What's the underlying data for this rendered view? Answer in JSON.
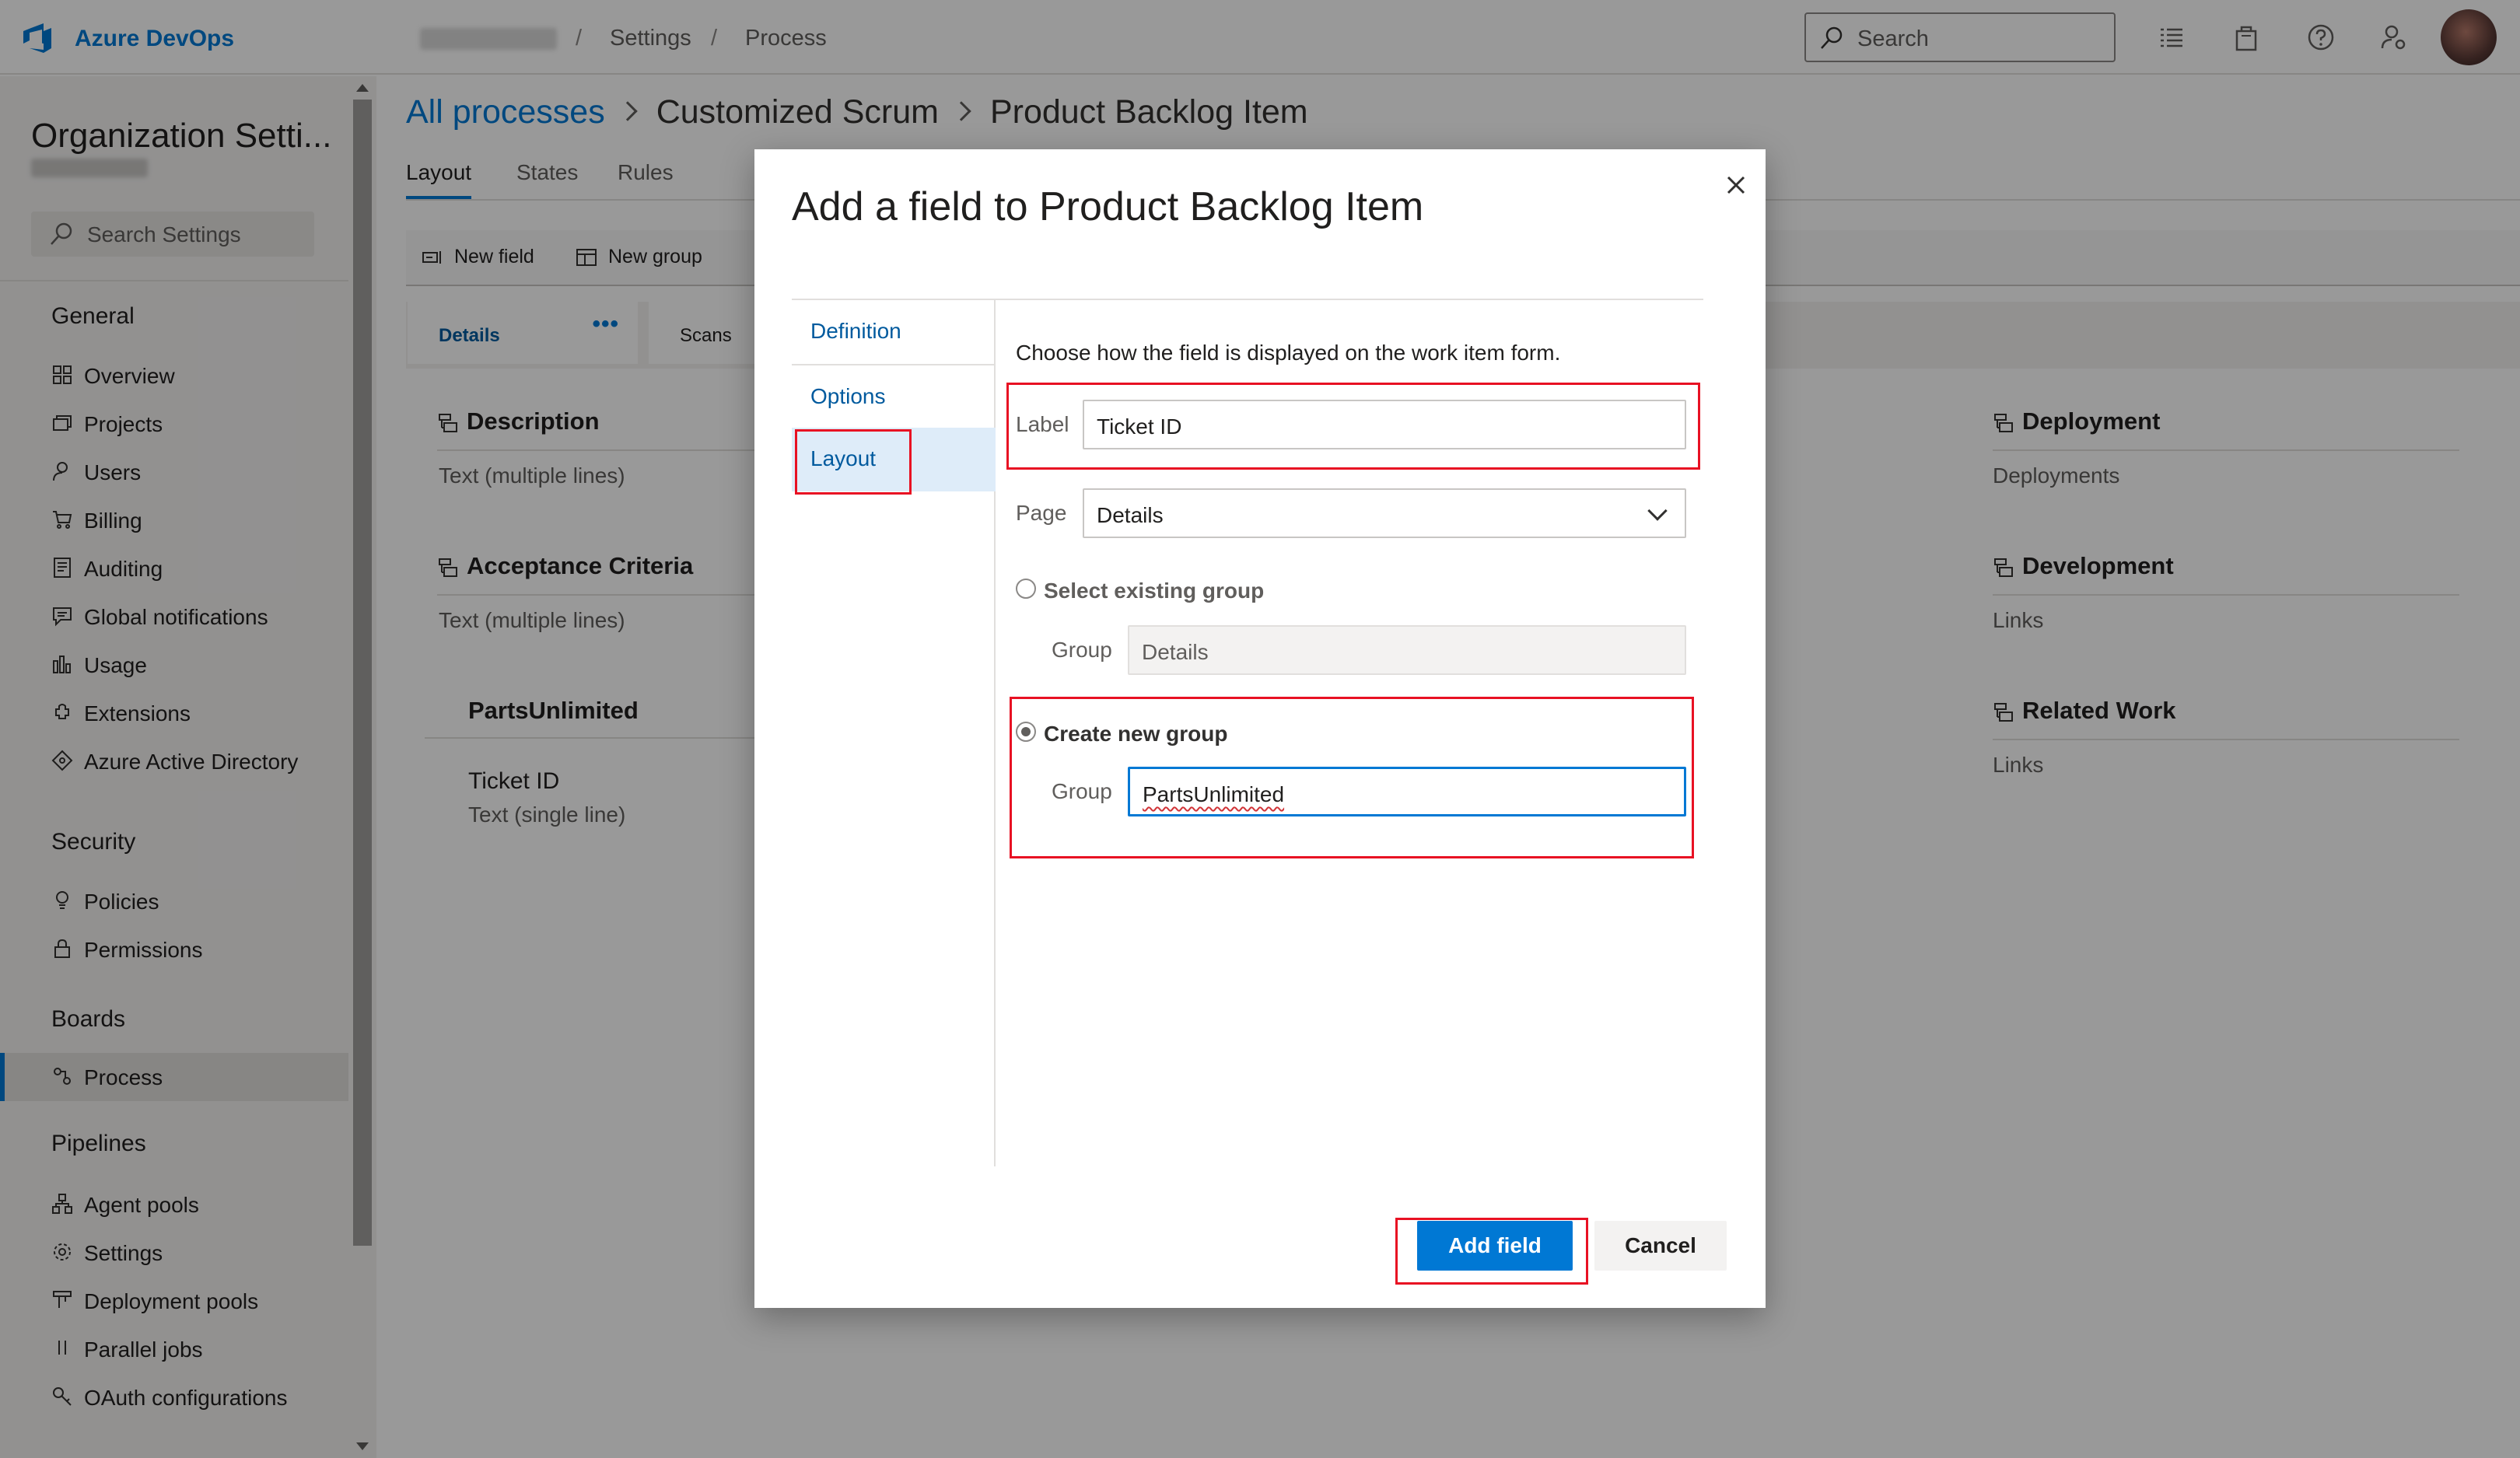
{
  "topbar": {
    "brand": "Azure DevOps",
    "breadcrumb": [
      "Settings",
      "Process"
    ],
    "search_placeholder": "Search"
  },
  "sidebar": {
    "title": "Organization Setti...",
    "search_placeholder": "Search Settings",
    "groups": [
      {
        "label": "General",
        "items": [
          "Overview",
          "Projects",
          "Users",
          "Billing",
          "Auditing",
          "Global notifications",
          "Usage",
          "Extensions",
          "Azure Active Directory"
        ]
      },
      {
        "label": "Security",
        "items": [
          "Policies",
          "Permissions"
        ]
      },
      {
        "label": "Boards",
        "items": [
          "Process"
        ]
      },
      {
        "label": "Pipelines",
        "items": [
          "Agent pools",
          "Settings",
          "Deployment pools",
          "Parallel jobs",
          "OAuth configurations"
        ]
      }
    ],
    "active_item": "Process"
  },
  "main": {
    "breadcrumb": [
      "All processes",
      "Customized Scrum",
      "Product Backlog Item"
    ],
    "tabs": [
      "Layout",
      "States",
      "Rules"
    ],
    "active_tab": "Layout",
    "toolbar": {
      "new_field": "New field",
      "new_group": "New group"
    },
    "page_tabs": [
      "Details",
      "Scans"
    ],
    "page_tab_more": "•••",
    "groups_left": [
      {
        "title": "Description",
        "text": "Text (multiple lines)"
      },
      {
        "title": "Acceptance Criteria",
        "text": "Text (multiple lines)"
      }
    ],
    "custom_group": {
      "title": "PartsUnlimited",
      "field_name": "Ticket ID",
      "field_type": "Text (single line)"
    },
    "groups_right": [
      {
        "title": "Deployment",
        "text": "Deployments"
      },
      {
        "title": "Development",
        "text": "Links"
      },
      {
        "title": "Related Work",
        "text": "Links"
      }
    ]
  },
  "dialog": {
    "title": "Add a field to Product Backlog Item",
    "nav": [
      "Definition",
      "Options",
      "Layout"
    ],
    "active_nav": "Layout",
    "description": "Choose how the field is displayed on the work item form.",
    "label_label": "Label",
    "label_value": "Ticket ID",
    "page_label": "Page",
    "page_value": "Details",
    "existing_group_label": "Select existing group",
    "group_label": "Group",
    "existing_group_value": "Details",
    "new_group_label": "Create new group",
    "new_group_value": "PartsUnlimited",
    "add_button": "Add field",
    "cancel_button": "Cancel"
  },
  "colors": {
    "accent": "#0078d4",
    "highlight": "#e81123",
    "overlay": "rgba(0,0,0,0.4)"
  },
  "icons": [
    "azure-devops-logo-icon",
    "search-icon",
    "list-icon",
    "shopping-bag-icon",
    "help-icon",
    "user-settings-icon",
    "close-icon",
    "chevron-down-icon",
    "group-icon"
  ]
}
